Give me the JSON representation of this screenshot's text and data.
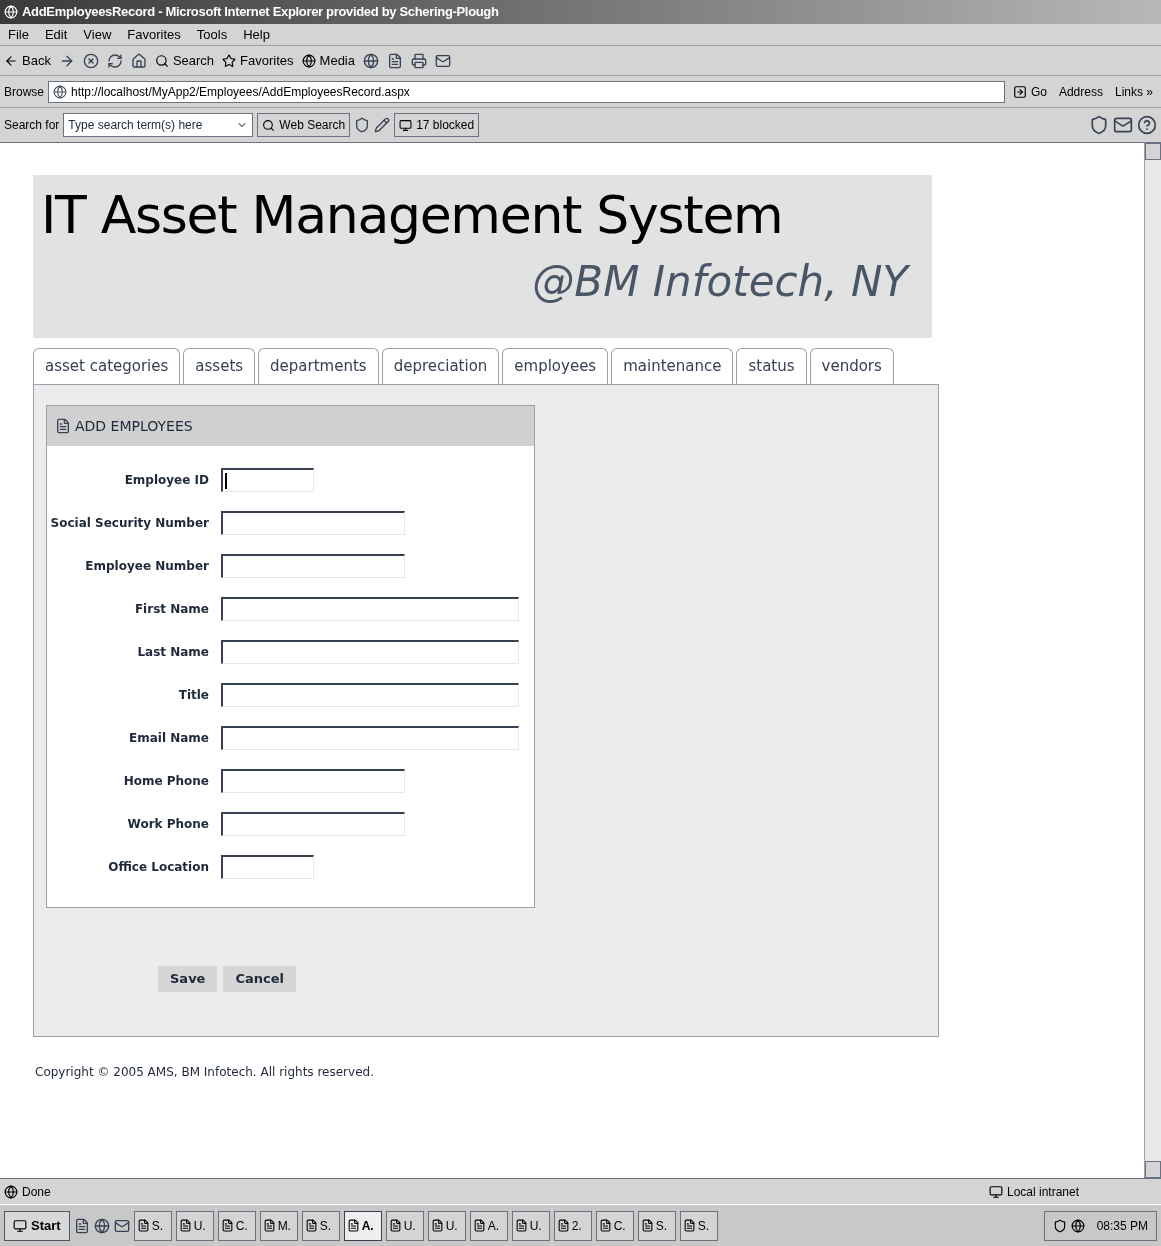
{
  "window": {
    "title": "AddEmployeesRecord - Microsoft Internet Explorer provided by Schering-Plough"
  },
  "menu": [
    "File",
    "Edit",
    "View",
    "Favorites",
    "Tools",
    "Help"
  ],
  "toolbar": {
    "back": "Back",
    "search": "Search",
    "favorites": "Favorites",
    "media": "Media"
  },
  "address_bar": {
    "label": "Browse",
    "url": "http://localhost/MyApp2/Employees/AddEmployeesRecord.aspx",
    "go": "Go",
    "address": "Address",
    "links": "Links »"
  },
  "search_bar": {
    "label": "Search for",
    "placeholder": "Type search term(s) here",
    "web_search": "Web Search",
    "blocked": "17 blocked"
  },
  "page": {
    "title": "IT Asset Management System",
    "subtitle": "@BM Infotech, NY",
    "tabs": [
      "asset categories",
      "assets",
      "departments",
      "depreciation",
      "employees",
      "maintenance",
      "status",
      "vendors"
    ],
    "form": {
      "heading": "ADD EMPLOYEES",
      "fields": [
        {
          "label": "Employee ID",
          "kind": "short",
          "focused": true
        },
        {
          "label": "Social Security Number",
          "kind": "medium",
          "focused": false
        },
        {
          "label": "Employee Number",
          "kind": "medium",
          "focused": false
        },
        {
          "label": "First Name",
          "kind": "long",
          "focused": false
        },
        {
          "label": "Last Name",
          "kind": "long",
          "focused": false
        },
        {
          "label": "Title",
          "kind": "long",
          "focused": false
        },
        {
          "label": "Email Name",
          "kind": "long",
          "focused": false
        },
        {
          "label": "Home Phone",
          "kind": "medium",
          "focused": false
        },
        {
          "label": "Work Phone",
          "kind": "medium",
          "focused": false
        },
        {
          "label": "Office Location",
          "kind": "short",
          "focused": false
        }
      ],
      "buttons": [
        "Save",
        "Cancel"
      ]
    },
    "footer": "Copyright © 2005 AMS, BM Infotech. All rights reserved."
  },
  "status_bar": {
    "text": "Done",
    "zone": "Local intranet"
  },
  "taskbar": {
    "start": "Start",
    "tasks": [
      {
        "label": "S.",
        "selected": false
      },
      {
        "label": "U.",
        "selected": false
      },
      {
        "label": "C.",
        "selected": false
      },
      {
        "label": "M.",
        "selected": false
      },
      {
        "label": "S.",
        "selected": false
      },
      {
        "label": "A.",
        "selected": true
      },
      {
        "label": "U.",
        "selected": false
      },
      {
        "label": "U.",
        "selected": false
      },
      {
        "label": "A.",
        "selected": false
      },
      {
        "label": "U.",
        "selected": false
      },
      {
        "label": "2.",
        "selected": false
      },
      {
        "label": "C.",
        "selected": false
      },
      {
        "label": "S.",
        "selected": false
      },
      {
        "label": "S.",
        "selected": false
      }
    ],
    "clock": "08:35 PM"
  }
}
